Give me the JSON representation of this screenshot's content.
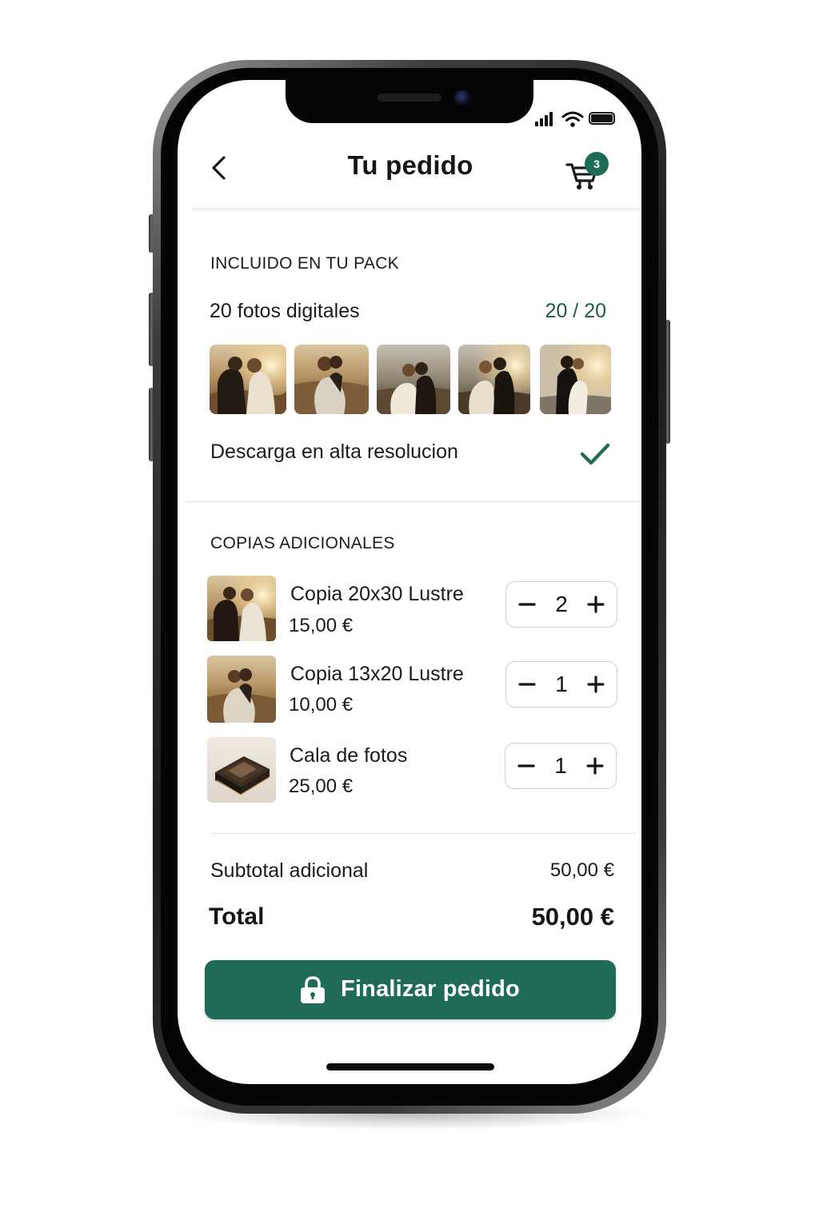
{
  "header": {
    "title": "Tu pedido",
    "cart_badge": "3"
  },
  "pack": {
    "section_title": "INCLUIDO EN TU PACK",
    "digital_label": "20 fotos digitales",
    "counter": "20 / 20",
    "download_label": "Descarga en alta resolucion"
  },
  "extras": {
    "section_title": "COPIAS ADICIONALES",
    "items": [
      {
        "name": "Copia 20x30 Lustre",
        "price": "15,00 €",
        "quantity": "2"
      },
      {
        "name": "Copia 13x20 Lustre",
        "price": "10,00 €",
        "quantity": "1"
      },
      {
        "name": "Cala de fotos",
        "price": "25,00 €",
        "quantity": "1"
      }
    ]
  },
  "summary": {
    "subtotal_label": "Subtotal adicional",
    "subtotal_value": "50,00 €",
    "total_label": "Total",
    "total_value": "50,00 €"
  },
  "cta": {
    "label": "Finalizar pedido"
  },
  "colors": {
    "accent": "#1f6b58",
    "text": "#1b1b1b"
  },
  "icons": [
    "back-chevron-icon",
    "cart-icon",
    "check-icon",
    "minus-icon",
    "plus-icon",
    "lock-icon",
    "signal-icon",
    "wifi-icon",
    "battery-icon"
  ]
}
